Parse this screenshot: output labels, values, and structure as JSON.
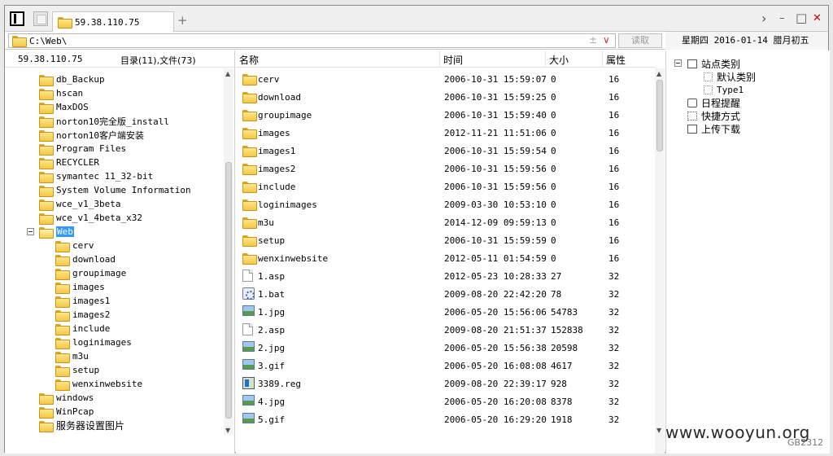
{
  "tab": {
    "title": "59.38.110.75",
    "plus": "+"
  },
  "window_controls": {
    "next": "›",
    "minimize": "–",
    "maximize": "□",
    "close": "✕"
  },
  "address": {
    "path": "C:\\Web\\",
    "aux_plus": "±",
    "aux_down": "∨",
    "read_button": "读取"
  },
  "date": {
    "text": "星期四 2016-01-14 腊月初五"
  },
  "left": {
    "host": "59.38.110.75",
    "summary": "目录(11),文件(73)",
    "tree": [
      {
        "label": "db_Backup"
      },
      {
        "label": "hscan"
      },
      {
        "label": "MaxDOS"
      },
      {
        "label": "norton10完全版_install"
      },
      {
        "label": "norton10客户端安装"
      },
      {
        "label": "Program Files"
      },
      {
        "label": "RECYCLER"
      },
      {
        "label": "symantec 11_32-bit"
      },
      {
        "label": "System Volume Information"
      },
      {
        "label": "wce_v1_3beta"
      },
      {
        "label": "wce_v1_4beta_x32"
      },
      {
        "label": "Web"
      },
      {
        "label": "cerv"
      },
      {
        "label": "download"
      },
      {
        "label": "groupimage"
      },
      {
        "label": "images"
      },
      {
        "label": "images1"
      },
      {
        "label": "images2"
      },
      {
        "label": "include"
      },
      {
        "label": "loginimages"
      },
      {
        "label": "m3u"
      },
      {
        "label": "setup"
      },
      {
        "label": "wenxinwebsite"
      },
      {
        "label": "windows"
      },
      {
        "label": "WinPcap"
      },
      {
        "label": "服务器设置图片"
      }
    ]
  },
  "list": {
    "headers": {
      "name": "名称",
      "time": "时间",
      "size": "大小",
      "attr": "属性"
    },
    "rows": [
      {
        "name": "cerv",
        "time": "2006-10-31 15:59:07",
        "size": "0",
        "attr": "16",
        "icon": "folder-icon"
      },
      {
        "name": "download",
        "time": "2006-10-31 15:59:25",
        "size": "0",
        "attr": "16",
        "icon": "folder-icon"
      },
      {
        "name": "groupimage",
        "time": "2006-10-31 15:59:40",
        "size": "0",
        "attr": "16",
        "icon": "folder-icon"
      },
      {
        "name": "images",
        "time": "2012-11-21 11:51:06",
        "size": "0",
        "attr": "16",
        "icon": "folder-icon"
      },
      {
        "name": "images1",
        "time": "2006-10-31 15:59:54",
        "size": "0",
        "attr": "16",
        "icon": "folder-icon"
      },
      {
        "name": "images2",
        "time": "2006-10-31 15:59:56",
        "size": "0",
        "attr": "16",
        "icon": "folder-icon"
      },
      {
        "name": "include",
        "time": "2006-10-31 15:59:56",
        "size": "0",
        "attr": "16",
        "icon": "folder-icon"
      },
      {
        "name": "loginimages",
        "time": "2009-03-30 10:53:10",
        "size": "0",
        "attr": "16",
        "icon": "folder-icon"
      },
      {
        "name": "m3u",
        "time": "2014-12-09 09:59:13",
        "size": "0",
        "attr": "16",
        "icon": "folder-icon"
      },
      {
        "name": "setup",
        "time": "2006-10-31 15:59:59",
        "size": "0",
        "attr": "16",
        "icon": "folder-icon"
      },
      {
        "name": "wenxinwebsite",
        "time": "2012-05-11 01:54:59",
        "size": "0",
        "attr": "16",
        "icon": "folder-icon"
      },
      {
        "name": "1.asp",
        "time": "2012-05-23 10:28:33",
        "size": "27",
        "attr": "32",
        "icon": "file-icon"
      },
      {
        "name": "1.bat",
        "time": "2009-08-20 22:42:20",
        "size": "78",
        "attr": "32",
        "icon": "bat-icon"
      },
      {
        "name": "1.jpg",
        "time": "2006-05-20 15:56:06",
        "size": "54783",
        "attr": "32",
        "icon": "image-icon"
      },
      {
        "name": "2.asp",
        "time": "2009-08-20 21:51:37",
        "size": "152838",
        "attr": "32",
        "icon": "file-icon"
      },
      {
        "name": "2.jpg",
        "time": "2006-05-20 15:56:38",
        "size": "20598",
        "attr": "32",
        "icon": "image-icon"
      },
      {
        "name": "3.gif",
        "time": "2006-05-20 16:08:08",
        "size": "4617",
        "attr": "32",
        "icon": "image-icon"
      },
      {
        "name": "3389.reg",
        "time": "2009-08-20 22:39:17",
        "size": "928",
        "attr": "32",
        "icon": "reg-icon"
      },
      {
        "name": "4.jpg",
        "time": "2006-05-20 16:20:08",
        "size": "8378",
        "attr": "32",
        "icon": "image-icon"
      },
      {
        "name": "5.gif",
        "time": "2006-05-20 16:29:20",
        "size": "1918",
        "attr": "32",
        "icon": "image-icon"
      }
    ]
  },
  "right": {
    "items": [
      {
        "label": "站点类别"
      },
      {
        "label": "默认类别"
      },
      {
        "label": "Type1"
      },
      {
        "label": "日程提醒"
      },
      {
        "label": "快捷方式"
      },
      {
        "label": "上传下载"
      }
    ]
  },
  "watermark": {
    "text": "www.wooyun.org",
    "code": "GB2312"
  }
}
